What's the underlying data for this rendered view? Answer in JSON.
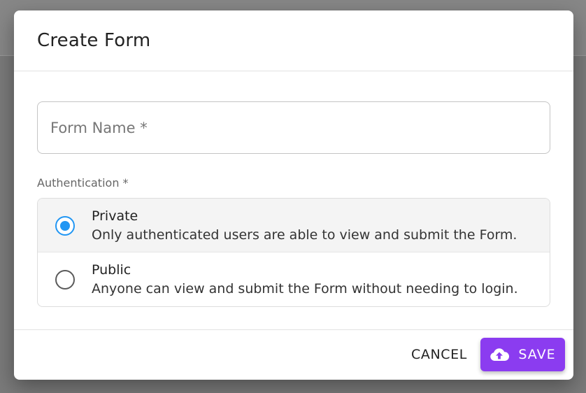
{
  "dialog": {
    "title": "Create Form",
    "form_name_placeholder": "Form Name *",
    "authentication_label": "Authentication *",
    "options": [
      {
        "title": "Private",
        "description": "Only authenticated users are able to view and submit the Form.",
        "selected": true
      },
      {
        "title": "Public",
        "description": "Anyone can view and submit the Form without needing to login.",
        "selected": false
      }
    ],
    "cancel_label": "CANCEL",
    "save_label": "SAVE",
    "save_icon": "cloud-upload-icon"
  },
  "colors": {
    "accent_radio": "#2196f3",
    "save_button": "#8b3cf0",
    "overlay": "#7a7a7a"
  }
}
